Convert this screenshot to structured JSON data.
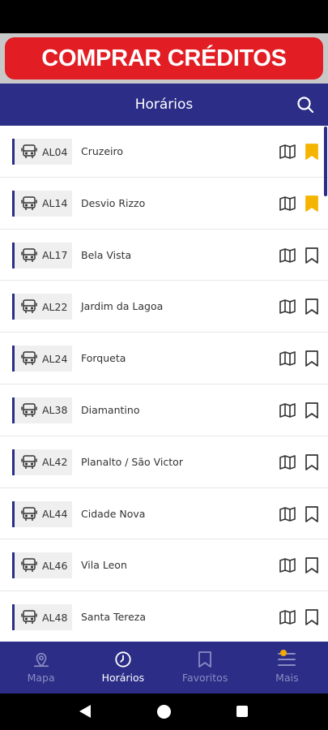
{
  "banner": {
    "label": "COMPRAR CRÉDITOS"
  },
  "header": {
    "title": "Horários",
    "search_icon": "search-icon"
  },
  "routes": [
    {
      "code": "AL04",
      "name": "Cruzeiro",
      "favorite": true
    },
    {
      "code": "AL14",
      "name": "Desvio Rizzo",
      "favorite": true
    },
    {
      "code": "AL17",
      "name": "Bela Vista",
      "favorite": false
    },
    {
      "code": "AL22",
      "name": "Jardim da Lagoa",
      "favorite": false
    },
    {
      "code": "AL24",
      "name": "Forqueta",
      "favorite": false
    },
    {
      "code": "AL38",
      "name": "Diamantino",
      "favorite": false
    },
    {
      "code": "AL42",
      "name": "Planalto / São Victor",
      "favorite": false
    },
    {
      "code": "AL44",
      "name": "Cidade Nova",
      "favorite": false
    },
    {
      "code": "AL46",
      "name": "Vila Leon",
      "favorite": false
    },
    {
      "code": "AL48",
      "name": "Santa Tereza",
      "favorite": false
    }
  ],
  "nav": {
    "items": [
      {
        "label": "Mapa",
        "icon": "map-pin-icon",
        "active": false
      },
      {
        "label": "Horários",
        "icon": "clock-icon",
        "active": true
      },
      {
        "label": "Favoritos",
        "icon": "bookmark-icon",
        "active": false
      },
      {
        "label": "Mais",
        "icon": "menu-icon",
        "active": false,
        "badge": true
      }
    ]
  },
  "colors": {
    "primary": "#2b2d87",
    "banner_red": "#e21d24",
    "favorite": "#f5b400",
    "inactive_nav": "#8a8cc3"
  }
}
